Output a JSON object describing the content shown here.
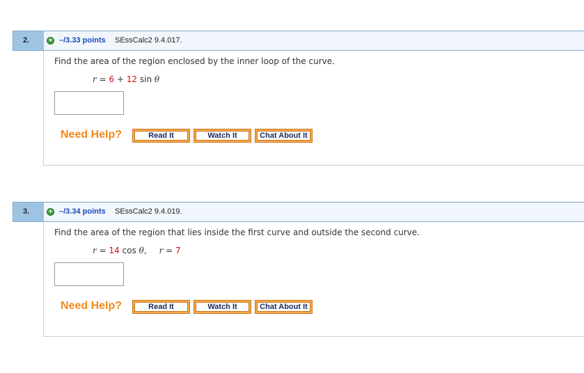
{
  "questions": [
    {
      "number": "2.",
      "points": "–/3.33 points",
      "code": "SEssCalc2 9.4.017.",
      "prompt": "Find the area of the region enclosed by the inner loop of the curve.",
      "formula": {
        "lhs": "r",
        "eq": " = ",
        "a": "6",
        "plus": " + ",
        "b": "12",
        "func": " sin ",
        "var": "θ"
      },
      "answer_value": ""
    },
    {
      "number": "3.",
      "points": "–/3.34 points",
      "code": "SEssCalc2 9.4.019.",
      "prompt": "Find the area of the region that lies inside the first curve and outside the second curve.",
      "formula": {
        "lhs": "r",
        "eq": " = ",
        "a": "14",
        "func": " cos ",
        "var": "θ",
        "sep": ",",
        "lhs2": "r",
        "eq2": " = ",
        "b": "7"
      },
      "answer_value": ""
    }
  ],
  "help": {
    "label": "Need Help?",
    "read": "Read It",
    "watch": "Watch It",
    "chat": "Chat About It"
  },
  "colors": {
    "header_bg": "#9ec4e4",
    "points_blue": "#1a49b8",
    "help_orange": "#f28a1d",
    "button_orange": "#f7a94a",
    "formula_red": "#d01010"
  },
  "icons": [
    "plus-icon"
  ]
}
